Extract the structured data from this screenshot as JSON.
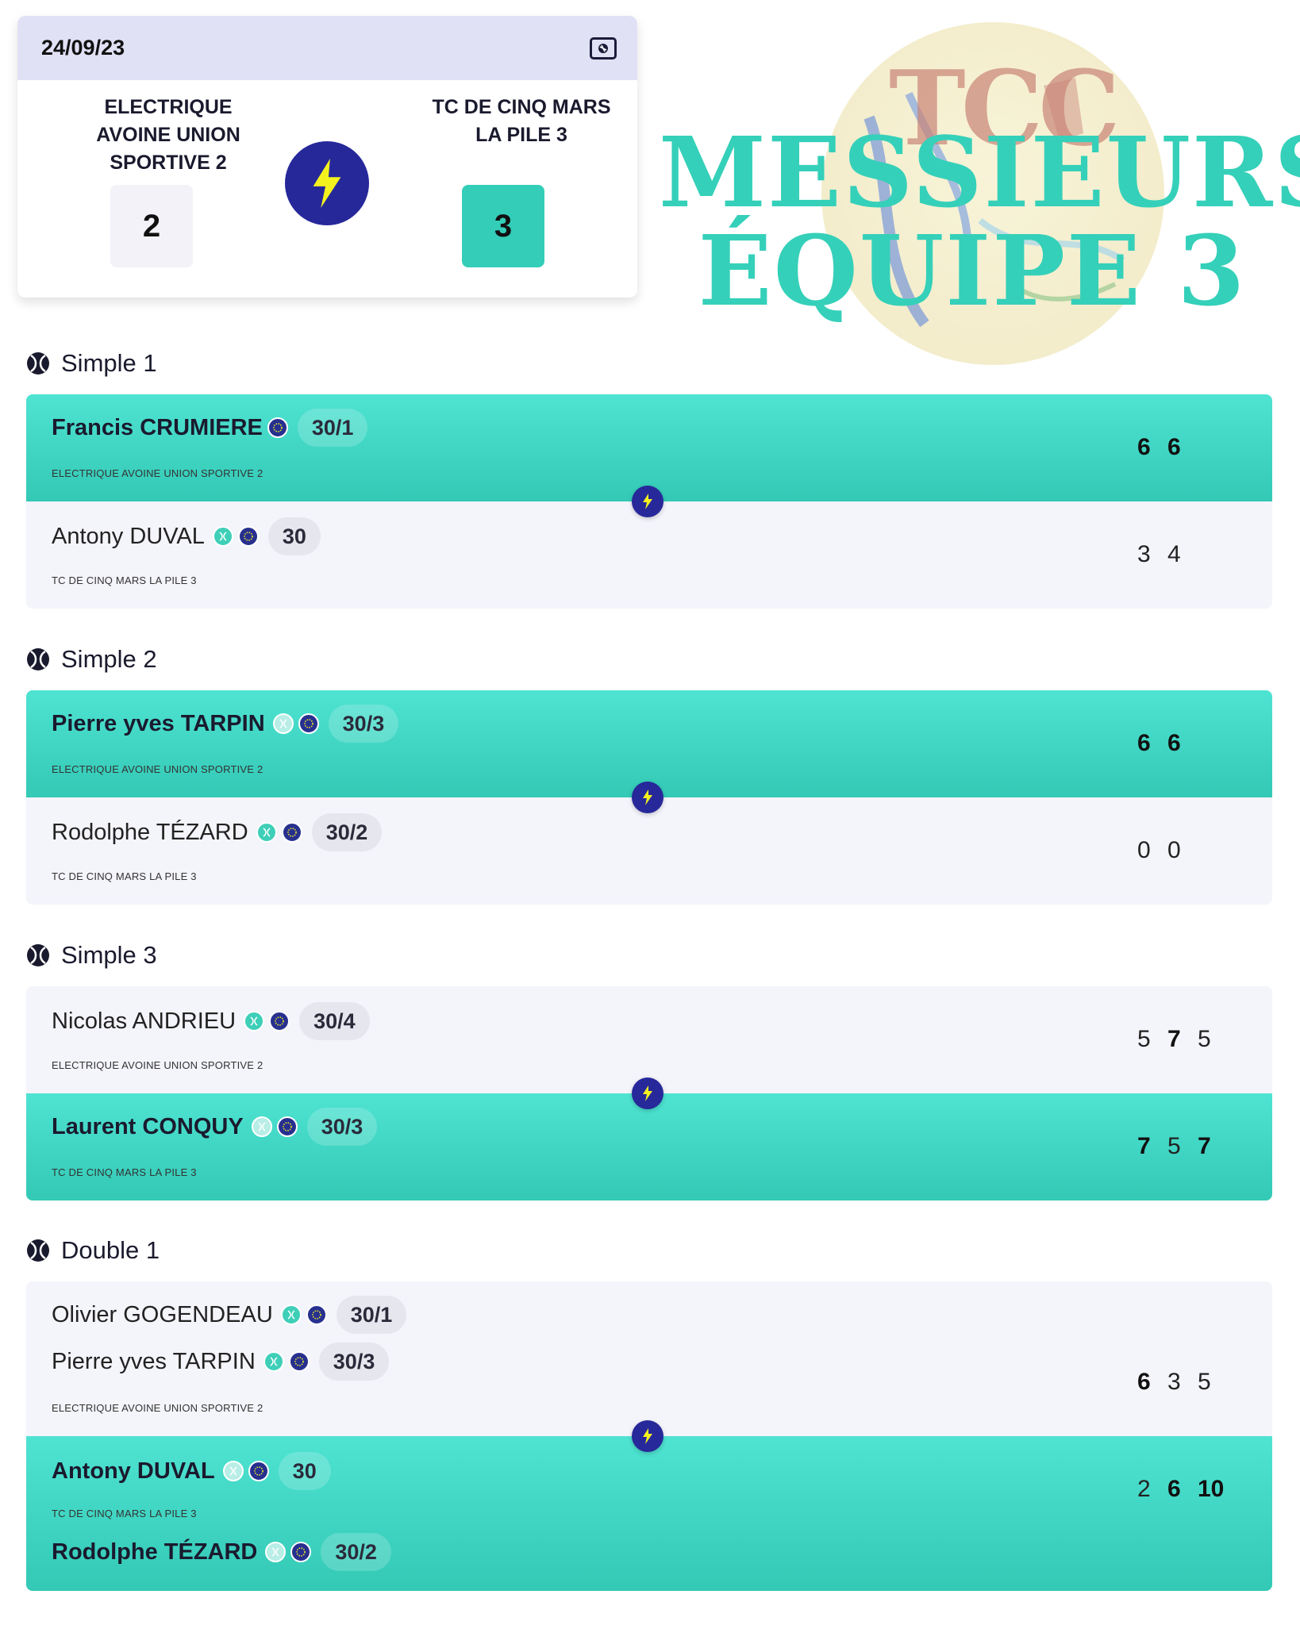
{
  "summary": {
    "date": "24/09/23",
    "home_team": "ELECTRIQUE AVOINE UNION SPORTIVE 2",
    "away_team": "TC DE CINQ MARS LA PILE 3",
    "home_score": "2",
    "away_score": "3"
  },
  "logo": {
    "tcc": "TCC",
    "line1": "MESSIEURS",
    "line2": "ÉQUIPE 3"
  },
  "matches": [
    {
      "title": "Simple 1",
      "top": {
        "players": [
          {
            "name": "Francis CRUMIERE",
            "rank": "30/1"
          }
        ],
        "club": "ELECTRIQUE AVOINE UNION SPORTIVE 2",
        "scores": [
          "6",
          "6"
        ]
      },
      "bottom": {
        "players": [
          {
            "name": "Antony DUVAL",
            "rank": "30"
          }
        ],
        "club": "TC DE CINQ MARS LA PILE 3",
        "scores": [
          "3",
          "4"
        ]
      }
    },
    {
      "title": "Simple 2",
      "top": {
        "players": [
          {
            "name": "Pierre yves TARPIN",
            "rank": "30/3"
          }
        ],
        "club": "ELECTRIQUE AVOINE UNION SPORTIVE 2",
        "scores": [
          "6",
          "6"
        ]
      },
      "bottom": {
        "players": [
          {
            "name": "Rodolphe TÉZARD",
            "rank": "30/2"
          }
        ],
        "club": "TC DE CINQ MARS LA PILE 3",
        "scores": [
          "0",
          "0"
        ]
      }
    },
    {
      "title": "Simple 3",
      "top": {
        "players": [
          {
            "name": "Nicolas ANDRIEU",
            "rank": "30/4"
          }
        ],
        "club": "ELECTRIQUE AVOINE UNION SPORTIVE 2",
        "scores": [
          "5",
          "7",
          "5"
        ]
      },
      "bottom": {
        "players": [
          {
            "name": "Laurent CONQUY",
            "rank": "30/3"
          }
        ],
        "club": "TC DE CINQ MARS LA PILE 3",
        "scores": [
          "7",
          "5",
          "7"
        ]
      }
    },
    {
      "title": "Double 1",
      "top": {
        "players": [
          {
            "name": "Olivier GOGENDEAU",
            "rank": "30/1"
          },
          {
            "name": "Pierre yves TARPIN",
            "rank": "30/3"
          }
        ],
        "club": "ELECTRIQUE AVOINE UNION SPORTIVE 2",
        "scores": [
          "6",
          "3",
          "5"
        ]
      },
      "bottom": {
        "players": [
          {
            "name": "Antony DUVAL",
            "rank": "30"
          },
          {
            "name": "Rodolphe TÉZARD",
            "rank": "30/2"
          }
        ],
        "club": "TC DE CINQ MARS LA PILE 3",
        "scores": [
          "2",
          "6",
          "10"
        ]
      }
    }
  ],
  "colors": {
    "winner_row": "#3fd6c4",
    "loser_row": "#f4f4fb",
    "bolt_circle": "#27289a",
    "bolt": "#f4f21e",
    "headline": "#35d0b9"
  }
}
